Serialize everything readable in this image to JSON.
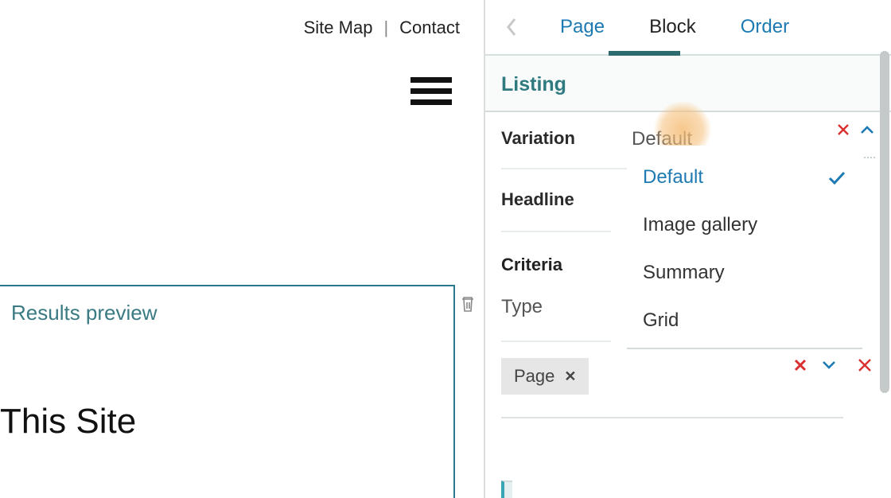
{
  "topnav": {
    "sitemap": "Site Map",
    "contact": "Contact"
  },
  "preview": {
    "title": "Results preview",
    "site_heading": "This Site"
  },
  "tabs": {
    "page": "Page",
    "block": "Block",
    "order": "Order"
  },
  "section": {
    "title": "Listing"
  },
  "fields": {
    "variation_label": "Variation",
    "variation_value": "Default",
    "headline_label": "Headline",
    "criteria_label": "Criteria",
    "type_label": "Type"
  },
  "variation_options": {
    "default": "Default",
    "image_gallery": "Image gallery",
    "summary": "Summary",
    "grid": "Grid"
  },
  "chip": {
    "page": "Page"
  },
  "icons": {
    "back": "back-icon",
    "close_red": "close-icon",
    "chevron_up": "chevron-up-icon",
    "chevron_down": "chevron-down-icon",
    "check": "check-icon",
    "delete_red": "delete-icon",
    "trash": "trash-icon",
    "hamburger": "menu-icon"
  },
  "colors": {
    "accent": "#1d7ab2",
    "teal": "#2f7a7f",
    "red": "#d9302f"
  }
}
